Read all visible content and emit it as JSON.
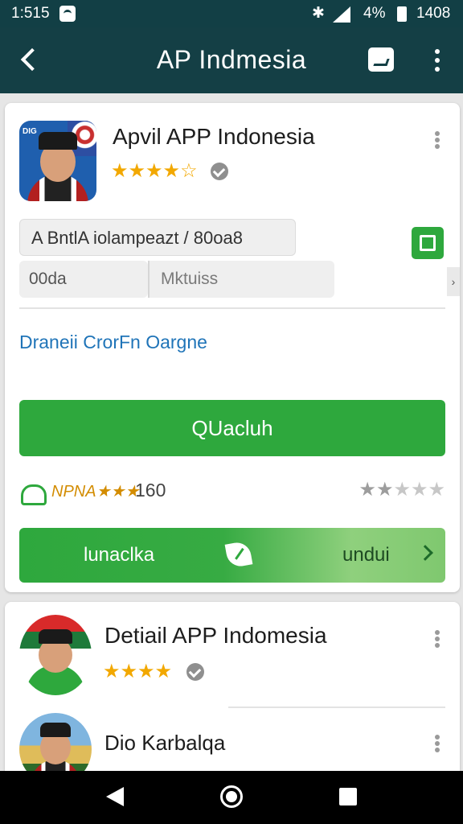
{
  "status_bar": {
    "time": "1:515",
    "battery_percent": "4%",
    "clock_right": "1408"
  },
  "app_bar": {
    "title": "AP Indmesia"
  },
  "card_main": {
    "avatar_label": "DIG",
    "app_name": "Apvil APP Indonesia",
    "stars": "★★★★☆",
    "path_field_value": "A BntlA iolampeazt / 80oa8",
    "field_a_value": "00da",
    "field_b_placeholder": "Mktuiss",
    "link_text": "Draneii CrorFn Oargne",
    "primary_button_label": "QUacluh",
    "rating_tag": "NPNA★★★",
    "rating_count": "160",
    "rating_stars_filled": 2,
    "install_left_label": "lunaclka",
    "install_right_label": "undui",
    "side_chevron": "›"
  },
  "card_second": {
    "app_name": "Detiail APP Indomesia",
    "stars": "★★★★",
    "sub_item_name": "Dio Karbalqa"
  },
  "colors": {
    "appbar": "#143f45",
    "accent_green": "#2ea83d",
    "star_gold": "#f2a800",
    "link_blue": "#1f74b8"
  },
  "icons": [
    "back-arrow-icon",
    "camera-icon",
    "more-vert-icon",
    "verified-icon",
    "checkbox-icon",
    "cloud-icon",
    "leaf-icon",
    "chevron-right-icon"
  ]
}
